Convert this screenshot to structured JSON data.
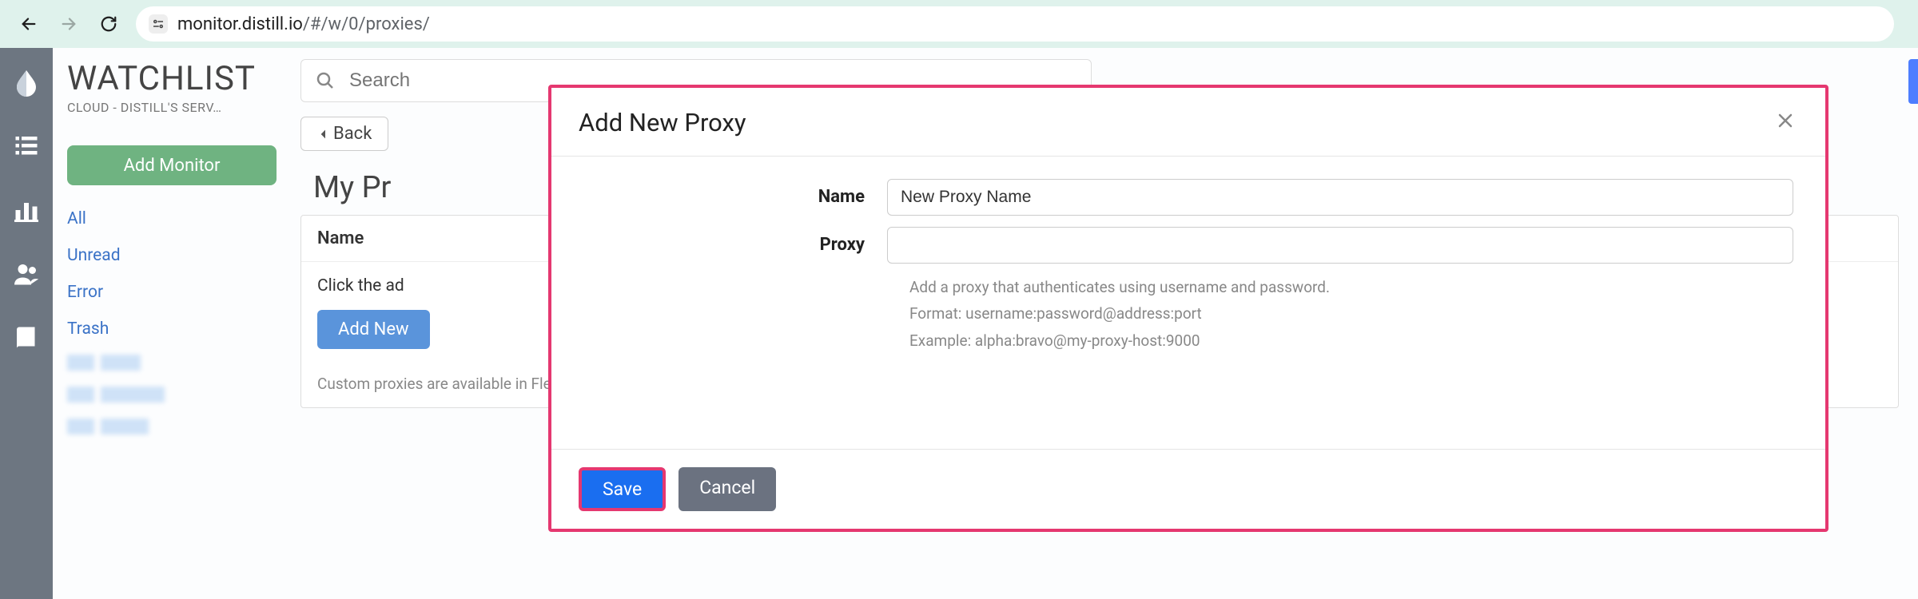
{
  "browser": {
    "url_domain": "monitor.distill.io",
    "url_path": "/#/w/0/proxies/"
  },
  "sidebar": {
    "title": "WATCHLIST",
    "subtitle": "CLOUD - DISTILL'S SERV…",
    "add_monitor_label": "Add Monitor",
    "filters": [
      "All",
      "Unread",
      "Error",
      "Trash"
    ]
  },
  "search": {
    "placeholder": "Search"
  },
  "toolbar": {
    "back_label": "Back"
  },
  "page": {
    "title_visible": "My Pr",
    "table_header": "Name",
    "empty_text": "Click the ad",
    "add_new_label": "Add New",
    "footer_note": "Custom proxies are available in Flexi in Enterprise plans"
  },
  "modal": {
    "title": "Add New Proxy",
    "name_label": "Name",
    "name_value": "New Proxy Name",
    "proxy_label": "Proxy",
    "proxy_value": "",
    "help_line1": "Add a proxy that authenticates using username and password.",
    "help_line2": "Format: username:password@address:port",
    "help_line3": "Example: alpha:bravo@my-proxy-host:9000",
    "save_label": "Save",
    "cancel_label": "Cancel"
  }
}
